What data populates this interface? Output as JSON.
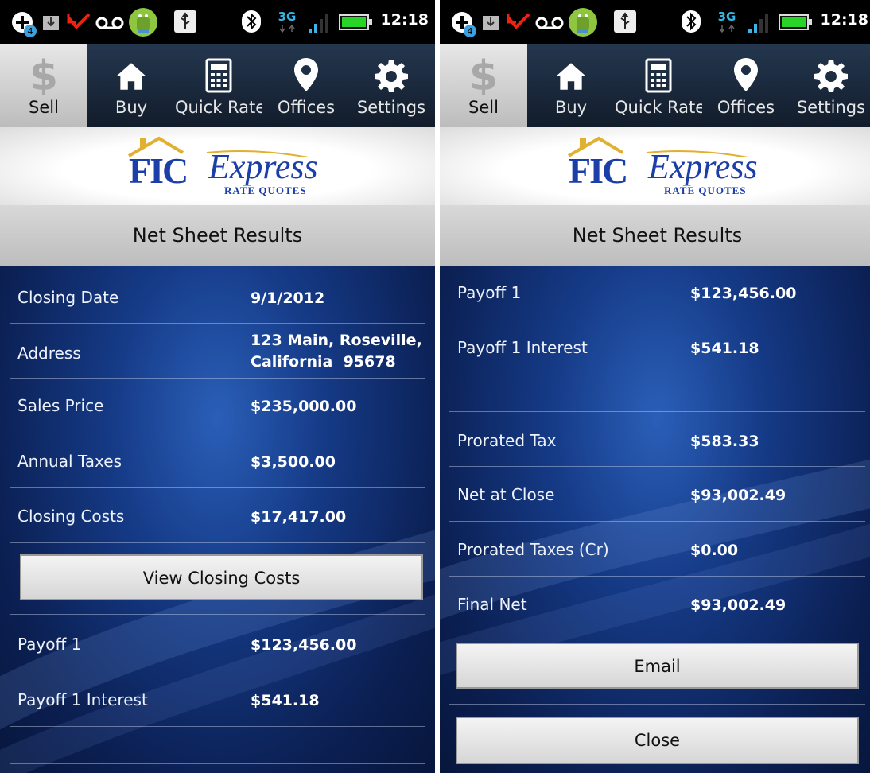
{
  "status_bar": {
    "time": "12:18",
    "notification_count": "4",
    "network": "3G",
    "icons": [
      "add-circle-icon",
      "download-icon",
      "missed-call-icon",
      "voicemail-icon",
      "android-icon",
      "usb-icon",
      "bluetooth-icon",
      "network-3g-icon",
      "signal-icon",
      "battery-icon"
    ]
  },
  "tabs": [
    {
      "label": "Sell",
      "icon": "dollar-icon",
      "active": true
    },
    {
      "label": "Buy",
      "icon": "home-icon",
      "active": false
    },
    {
      "label": "Quick Rate",
      "icon": "calculator-icon",
      "active": false
    },
    {
      "label": "Offices",
      "icon": "map-pin-icon",
      "active": false
    },
    {
      "label": "Settings",
      "icon": "gear-icon",
      "active": false
    }
  ],
  "logo": {
    "brand": "FIC",
    "name": "Express",
    "tagline": "RATE QUOTES"
  },
  "title": "Net Sheet Results",
  "left_screen": {
    "rows": [
      {
        "label": "Closing Date",
        "value": "9/1/2012"
      },
      {
        "label": "Address",
        "value_line1": "123 Main, Roseville,",
        "value_line2": "California  95678"
      },
      {
        "label": "Sales Price",
        "value": "$235,000.00"
      },
      {
        "label": "Annual Taxes",
        "value": "$3,500.00"
      },
      {
        "label": "Closing Costs",
        "value": "$17,417.00"
      }
    ],
    "view_closing_costs_label": "View Closing Costs",
    "rows_after": [
      {
        "label": "Payoff 1",
        "value": "$123,456.00"
      },
      {
        "label": "Payoff 1 Interest",
        "value": "$541.18"
      }
    ]
  },
  "right_screen": {
    "rows": [
      {
        "label": "Payoff 1",
        "value": "$123,456.00"
      },
      {
        "label": "Payoff 1 Interest",
        "value": "$541.18"
      },
      {
        "label": "",
        "value": ""
      },
      {
        "label": "Prorated Tax",
        "value": "$583.33"
      },
      {
        "label": "Net at Close",
        "value": "$93,002.49"
      },
      {
        "label": "Prorated Taxes (Cr)",
        "value": "$0.00"
      },
      {
        "label": "Final Net",
        "value": "$93,002.49"
      }
    ],
    "email_label": "Email",
    "close_label": "Close"
  },
  "colors": {
    "accent": "#1b3ea8",
    "background": "#0b1f52",
    "tabbar": "#1a2a3f"
  }
}
